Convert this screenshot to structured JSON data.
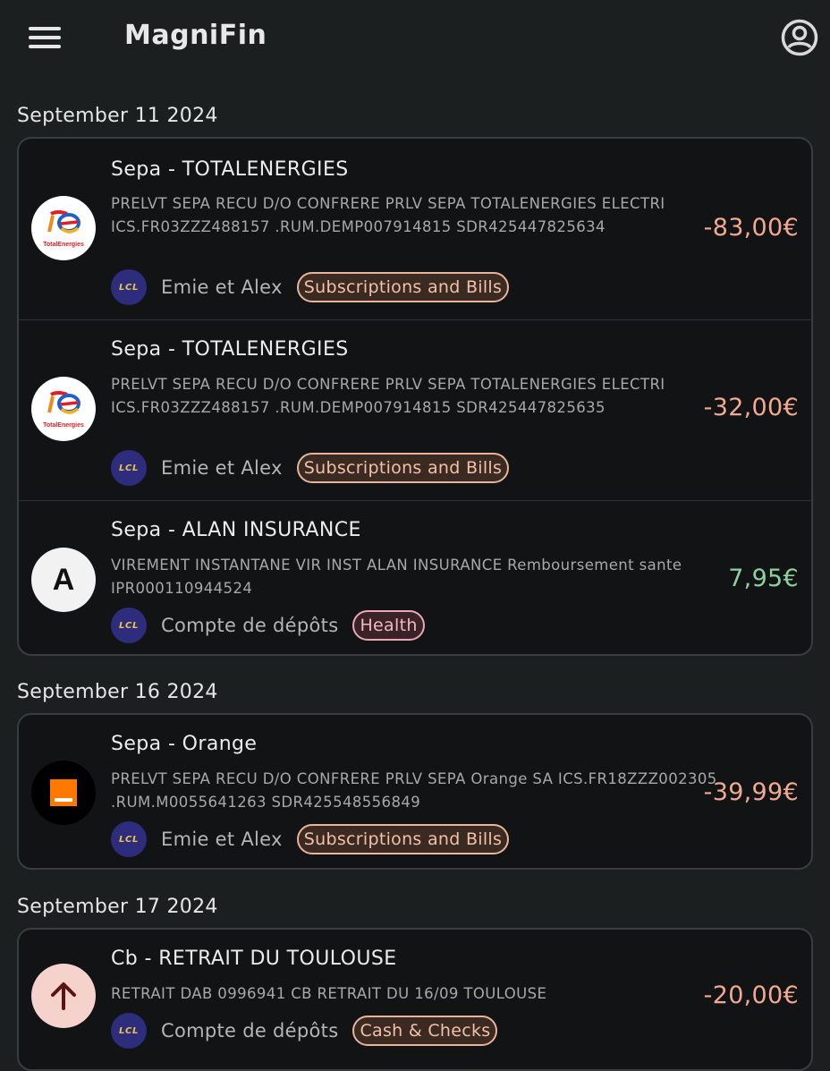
{
  "app": {
    "title": "MagniFin"
  },
  "colors": {
    "background": "#1c1f20",
    "card": "#121314",
    "negative_amount": "#f2a991",
    "positive_amount": "#8fd0a0",
    "bank_logo_bg": "#2d2c7d",
    "bank_logo_fg": "#e7c64b"
  },
  "icons": {
    "menu": "hamburger-menu-icon",
    "account": "account-circle-icon"
  },
  "groups": [
    {
      "date": "September 11 2024",
      "transactions": [
        {
          "title": "Sepa - TOTALENERGIES",
          "description": "PRELVT SEPA RECU D/O CONFRERE PRLV SEPA TOTALENERGIES ELECTRI ICS.FR03ZZZ488157 .RUM.DEMP007914815 SDR425447825634",
          "bank": "LCL",
          "account": "Emie et Alex",
          "category": "Subscriptions and Bills",
          "amount": "-83,00€",
          "logo_text": "TotalEnergies"
        },
        {
          "title": "Sepa - TOTALENERGIES",
          "description": "PRELVT SEPA RECU D/O CONFRERE PRLV SEPA TOTALENERGIES ELECTRI ICS.FR03ZZZ488157 .RUM.DEMP007914815 SDR425447825635",
          "bank": "LCL",
          "account": "Emie et Alex",
          "category": "Subscriptions and Bills",
          "amount": "-32,00€",
          "logo_text": "TotalEnergies"
        },
        {
          "title": "Sepa - ALAN INSURANCE",
          "description": "VIREMENT INSTANTANE VIR INST ALAN INSURANCE Remboursement sante IPR000110944524",
          "bank": "LCL",
          "account": "Compte de dépôts",
          "category": "Health",
          "amount": "7,95€",
          "logo_text": "A"
        }
      ]
    },
    {
      "date": "September 16 2024",
      "transactions": [
        {
          "title": "Sepa - Orange",
          "description": "PRELVT SEPA RECU D/O CONFRERE PRLV SEPA Orange SA ICS.FR18ZZZ002305 .RUM.M0055641263 SDR425548556849",
          "bank": "LCL",
          "account": "Emie et Alex",
          "category": "Subscriptions and Bills",
          "amount": "-39,99€"
        }
      ]
    },
    {
      "date": "September 17 2024",
      "transactions": [
        {
          "title": "Cb - RETRAIT DU TOULOUSE",
          "description": "RETRAIT DAB 0996941 CB RETRAIT DU 16/09 TOULOUSE",
          "bank": "LCL",
          "account": "Compte de dépôts",
          "category": "Cash & Checks",
          "amount": "-20,00€",
          "logo_icon": "arrow-up-icon"
        }
      ]
    }
  ]
}
